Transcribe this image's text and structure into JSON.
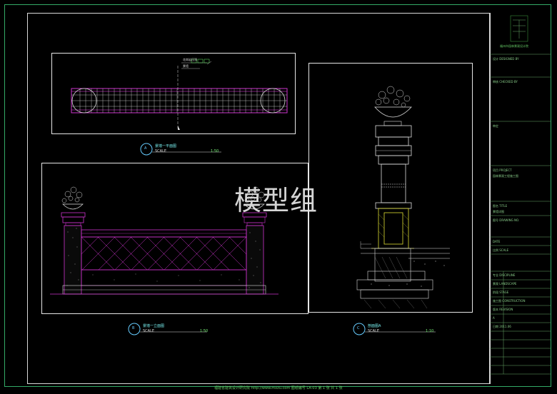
{
  "watermark": "模型组",
  "views": [
    {
      "letter": "A",
      "title": "景墙一平面图",
      "scale": "SCALE",
      "ratio": "1:50"
    },
    {
      "letter": "B",
      "title": "景墙一立面图",
      "scale": "SCALE",
      "ratio": "1:50"
    },
    {
      "letter": "C",
      "title": "剖面图A",
      "scale": "SCALE",
      "ratio": "1:10"
    }
  ],
  "plan_callout": {
    "line1": "花岗岩压顶",
    "line2": "景墙"
  },
  "title_block": {
    "company": "福州市园林景观设计院",
    "rows": [
      "设计 DESIGNED BY",
      "审核 CHECKED BY",
      "审定",
      "项目 PROJECT",
      "园林景观工程施工图",
      "图名 TITLE",
      "景墙详图",
      "图号 DRAWING NO.",
      "DATE",
      "比例 SCALE",
      "专业 DISCIPLINE",
      "景观 LANDSCAPE",
      "阶段 STAGE",
      "施工图 CONSTRUCTION",
      "版本 REVISION",
      "A",
      "日期 2011.06"
    ]
  },
  "footer": "福建省建筑设计研究院   http://www.mxzu.com   图纸编号 LA-03  第 1 张 共 1 张"
}
